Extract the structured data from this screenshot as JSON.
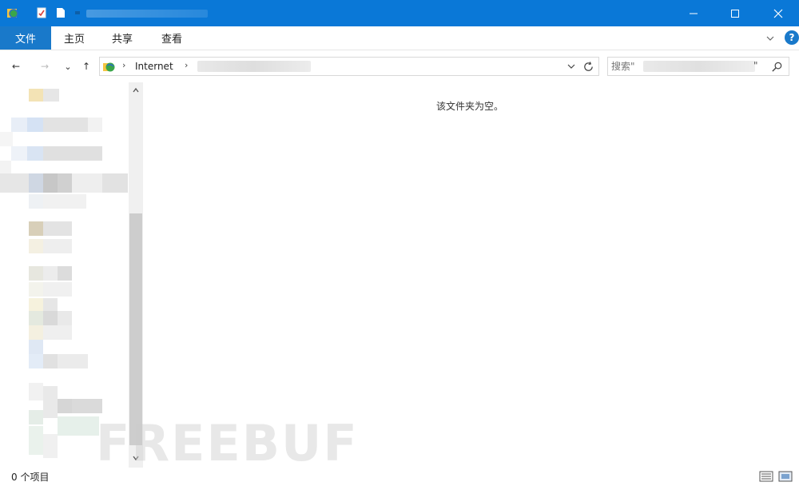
{
  "window": {
    "title_blurred": true,
    "controls": {
      "minimize": "minimize-icon",
      "maximize": "maximize-icon",
      "close": "close-icon"
    }
  },
  "ribbon": {
    "file_tab": "文件",
    "tabs": [
      "主页",
      "共享",
      "查看"
    ]
  },
  "navigation": {
    "back": "←",
    "forward": "→",
    "recent": "⌄",
    "up": "↑"
  },
  "address": {
    "crumbs": [
      "Internet"
    ],
    "separator": "›"
  },
  "search": {
    "placeholder": "搜索\"",
    "suffix": "\""
  },
  "content": {
    "empty_message": "该文件夹为空。"
  },
  "status": {
    "item_count": "0 个项目"
  },
  "watermark": "FREEBUF",
  "colors": {
    "titlebar": "#0a78d7",
    "file_tab": "#1979ca",
    "help": "#1979ca"
  }
}
